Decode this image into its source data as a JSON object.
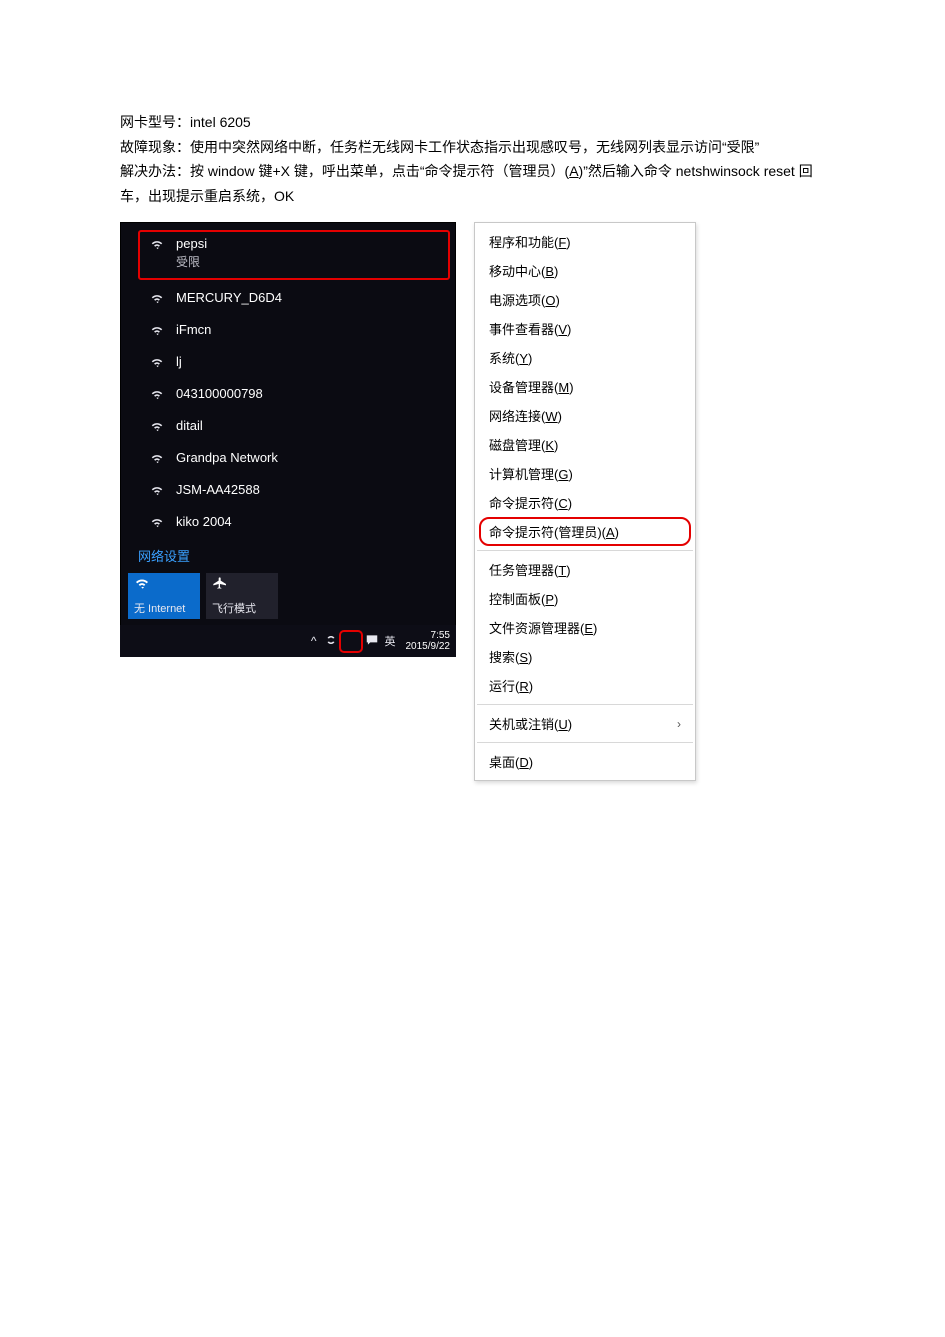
{
  "doc": {
    "line1_label": "网卡型号：",
    "line1_value": "intel 6205",
    "line2": "故障现象：使用中突然网络中断，任务栏无线网卡工作状态指示出现感叹号，无线网列表显示访问“受限”",
    "line3_a": "解决办法：按 window 键+X 键，呼出菜单，点击“命令提示符（管理员）(",
    "line3_accel": "A",
    "line3_b": ")”然后输入命令 netshwinsock reset  回车，出现提示重启系统，OK"
  },
  "wifi": {
    "networks": [
      {
        "name": "pepsi",
        "sub": "受限",
        "primary": true
      },
      {
        "name": "MERCURY_D6D4"
      },
      {
        "name": "iFmcn"
      },
      {
        "name": "lj"
      },
      {
        "name": "043100000798"
      },
      {
        "name": "ditail"
      },
      {
        "name": "Grandpa Network"
      },
      {
        "name": "JSM-AA42588"
      },
      {
        "name": "kiko 2004"
      }
    ],
    "settings_label": "网络设置",
    "tiles": {
      "wifi_label": "无 Internet",
      "airplane_label": "飞行模式"
    }
  },
  "taskbar": {
    "ime": "英",
    "time": "7:55",
    "date": "2015/9/22"
  },
  "menu": {
    "groups": [
      [
        {
          "label": "程序和功能",
          "accel": "F"
        },
        {
          "label": "移动中心",
          "accel": "B"
        },
        {
          "label": "电源选项",
          "accel": "O"
        },
        {
          "label": "事件查看器",
          "accel": "V"
        },
        {
          "label": "系统",
          "accel": "Y"
        },
        {
          "label": "设备管理器",
          "accel": "M"
        },
        {
          "label": "网络连接",
          "accel": "W"
        },
        {
          "label": "磁盘管理",
          "accel": "K"
        },
        {
          "label": "计算机管理",
          "accel": "G"
        },
        {
          "label": "命令提示符",
          "accel": "C"
        },
        {
          "label": "命令提示符(管理员)",
          "accel": "A",
          "highlighted": true
        }
      ],
      [
        {
          "label": "任务管理器",
          "accel": "T"
        },
        {
          "label": "控制面板",
          "accel": "P"
        },
        {
          "label": "文件资源管理器",
          "accel": "E"
        },
        {
          "label": "搜索",
          "accel": "S"
        },
        {
          "label": "运行",
          "accel": "R"
        }
      ],
      [
        {
          "label": "关机或注销",
          "accel": "U",
          "submenu": true
        }
      ],
      [
        {
          "label": "桌面",
          "accel": "D"
        }
      ]
    ]
  }
}
